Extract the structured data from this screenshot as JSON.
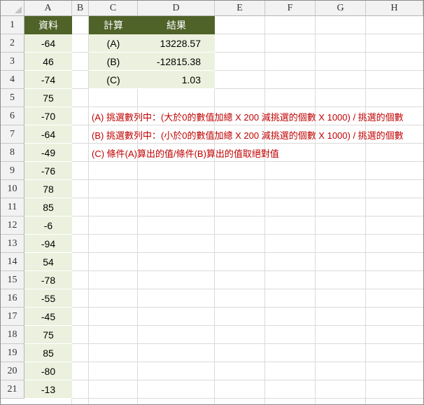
{
  "columns": [
    "A",
    "B",
    "C",
    "D",
    "E",
    "F",
    "G",
    "H"
  ],
  "rows": [
    "1",
    "2",
    "3",
    "4",
    "5",
    "6",
    "7",
    "8",
    "9",
    "10",
    "11",
    "12",
    "13",
    "14",
    "15",
    "16",
    "17",
    "18",
    "19",
    "20",
    "21"
  ],
  "data_header": "資料",
  "data_values": [
    "-64",
    "46",
    "-74",
    "75",
    "-70",
    "-64",
    "-49",
    "-76",
    "78",
    "85",
    "-6",
    "-94",
    "54",
    "-78",
    "-55",
    "-45",
    "75",
    "85",
    "-80",
    "-13"
  ],
  "calc": {
    "header_label": "計算",
    "header_result": "結果",
    "rows": [
      {
        "label": "(A)",
        "value": "13228.57"
      },
      {
        "label": "(B)",
        "value": "-12815.38"
      },
      {
        "label": "(C)",
        "value": "1.03"
      }
    ]
  },
  "notes": [
    "(A) 挑選數列中：(大於0的數值加總 X 200 減挑選的個數 X 1000) / 挑選的個數",
    "(B) 挑選數列中：(小於0的數值加總 X 200 減挑選的個數 X 1000) / 挑選的個數",
    "(C) 條件(A)算出的值/條件(B)算出的值取絕對值"
  ]
}
